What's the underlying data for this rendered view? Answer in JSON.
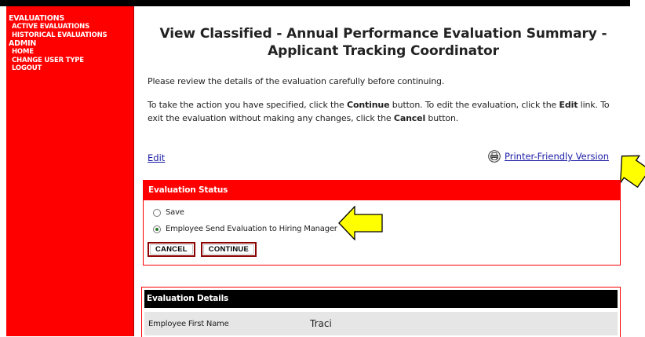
{
  "sidebar": {
    "sections": [
      {
        "label": "EVALUATIONS",
        "items": [
          "ACTIVE EVALUATIONS",
          "HISTORICAL EVALUATIONS"
        ]
      },
      {
        "label": "ADMIN",
        "items": [
          "HOME",
          "CHANGE USER TYPE",
          "LOGOUT"
        ]
      }
    ]
  },
  "page": {
    "title_line1": "View Classified - Annual Performance Evaluation Summary -",
    "title_line2": "Applicant Tracking Coordinator",
    "intro": "Please review the details of the evaluation carefully before continuing.",
    "instructions": {
      "part1": "To take the action you have specified, click the ",
      "continue_word": "Continue",
      "part2": " button. To edit the evaluation, click the ",
      "edit_word": "Edit",
      "part3": " link. To exit the evaluation without making any changes, click the ",
      "cancel_word": "Cancel",
      "part4": " button."
    },
    "edit_link": "Edit",
    "printer_link": "Printer-Friendly Version"
  },
  "status": {
    "heading": "Evaluation Status",
    "options": [
      {
        "label": "Save",
        "selected": false
      },
      {
        "label": "Employee Send Evaluation to Hiring Manager",
        "selected": true
      }
    ],
    "cancel_label": "CANCEL",
    "continue_label": "CONTINUE"
  },
  "details": {
    "heading": "Evaluation Details",
    "rows": [
      {
        "label": "Employee First Name",
        "value": "Traci"
      }
    ]
  },
  "colors": {
    "accent": "#ff0000",
    "highlight_arrow": "#ffff00",
    "link": "#1a1aa6"
  }
}
